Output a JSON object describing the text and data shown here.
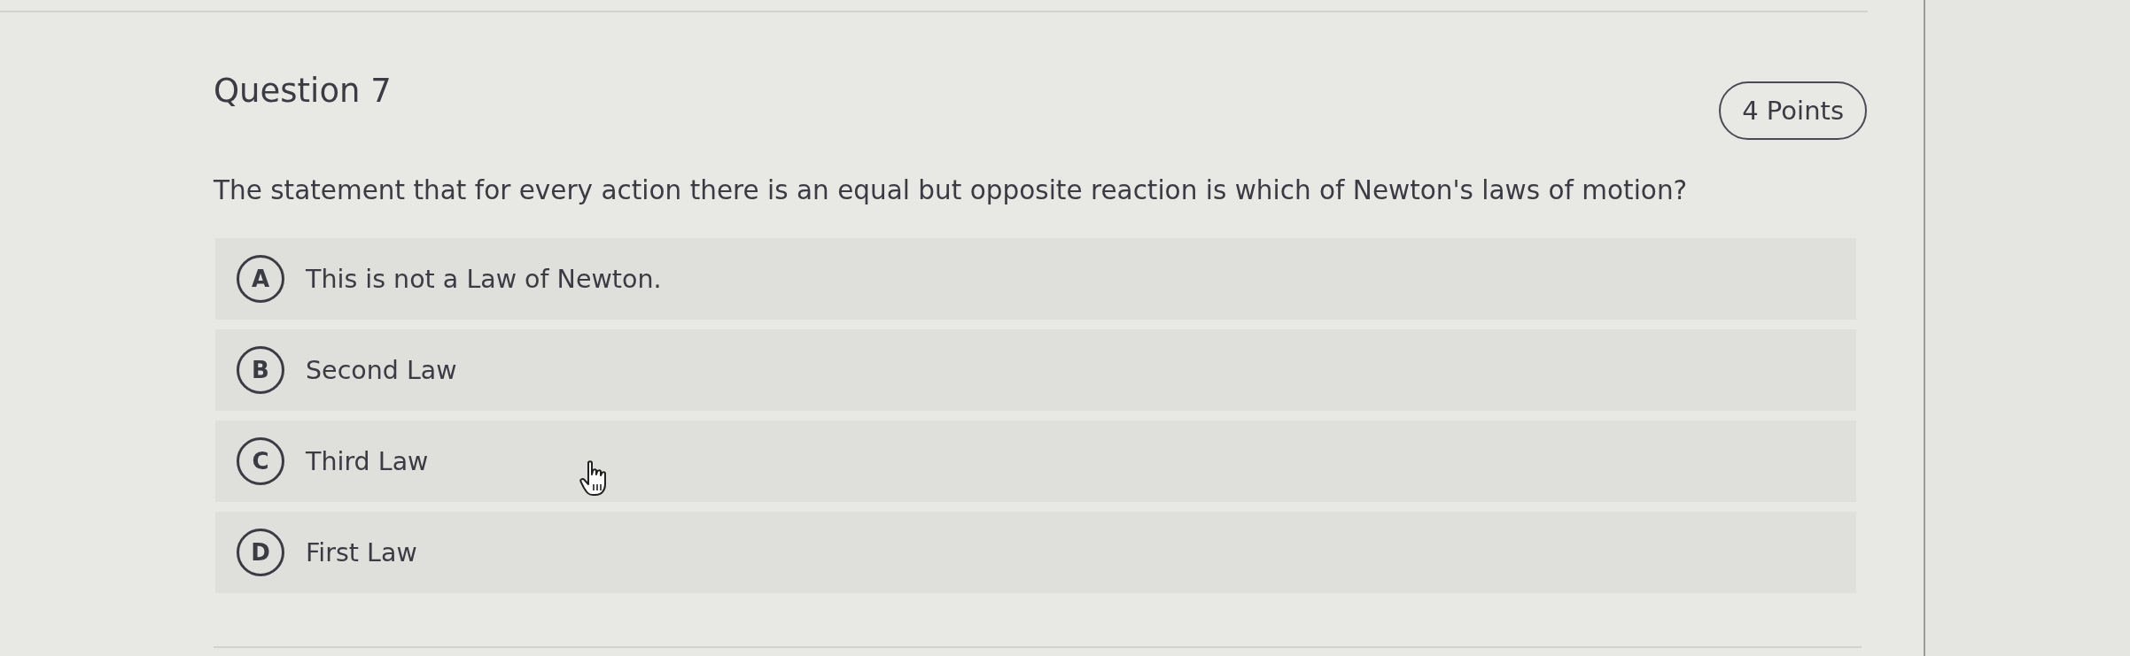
{
  "question": {
    "title": "Question 7",
    "points": "4 Points",
    "prompt": "The statement that for every action there is an equal but opposite reaction is which of Newton's laws of motion?"
  },
  "options": [
    {
      "letter": "A",
      "text": "This is not a Law of Newton.",
      "selected": false
    },
    {
      "letter": "B",
      "text": "Second Law",
      "selected": false
    },
    {
      "letter": "C",
      "text": "Third Law",
      "selected": false
    },
    {
      "letter": "D",
      "text": "First Law",
      "selected": false
    }
  ]
}
